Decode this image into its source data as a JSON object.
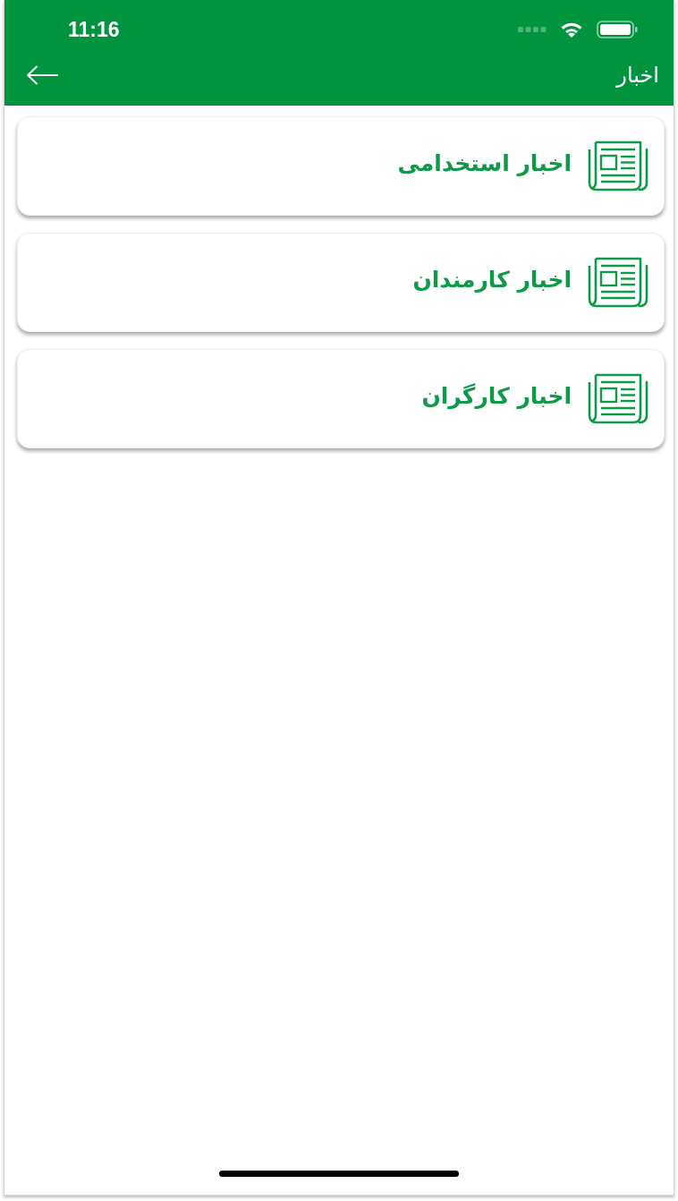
{
  "status_bar": {
    "time": "11:16"
  },
  "header": {
    "title": "اخبار"
  },
  "items": [
    {
      "label": "اخبار استخدامی"
    },
    {
      "label": "اخبار کارمندان"
    },
    {
      "label": "اخبار کارگران"
    }
  ]
}
